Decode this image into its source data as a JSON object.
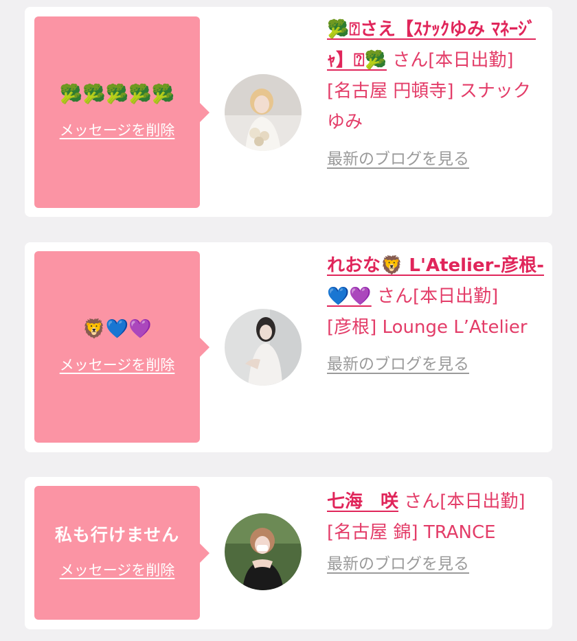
{
  "messages": [
    {
      "bubble_text": "🥦🥦🥦🥦🥦",
      "delete_label": "メッセージを削除",
      "cast_name": "🥦⍰さえ【ｽﾅｯｸゆみ ﾏﾈｰｼﾞｬ】⍰🥦",
      "name_suffix": "さん[本日出勤]",
      "shop": "[名古屋 円頓寺] スナック ゆみ",
      "blog_label": "最新のブログを見る"
    },
    {
      "bubble_text": "🦁💙💜",
      "delete_label": "メッセージを削除",
      "cast_name": "れおな🦁 L'Atelier-彦根-💙💜",
      "name_suffix": "さん[本日出勤]",
      "shop": "[彦根] Lounge L’Atelier",
      "blog_label": "最新のブログを見る"
    },
    {
      "bubble_text": "私も行けません",
      "delete_label": "メッセージを削除",
      "cast_name": "七海　咲",
      "name_suffix": "さん[本日出勤]",
      "shop": "[名古屋 錦] TRANCE",
      "blog_label": "最新のブログを見る"
    }
  ],
  "colors": {
    "background": "#f1f0f2",
    "card": "#ffffff",
    "bubble": "#fb94a4",
    "accent_text": "#e33c68",
    "link_gray": "#9a9a9a"
  }
}
